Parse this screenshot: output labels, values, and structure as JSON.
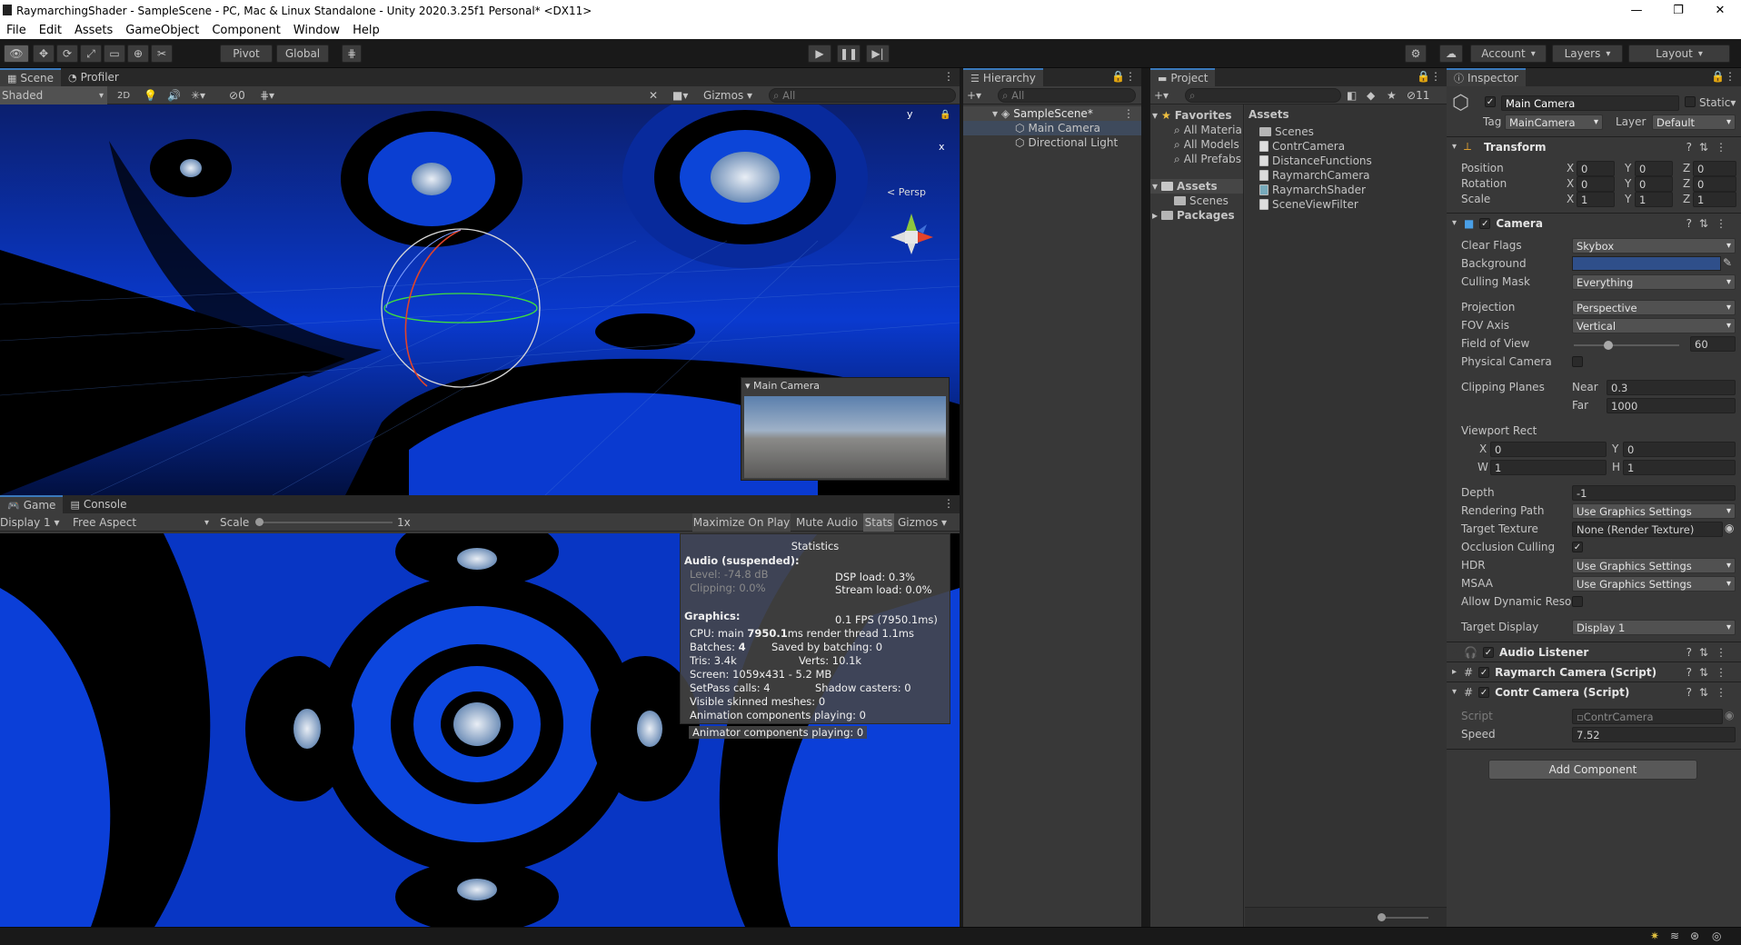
{
  "window": {
    "title": "RaymarchingShader - SampleScene - PC, Mac & Linux Standalone - Unity 2020.3.25f1 Personal* <DX11>",
    "minimize": "—",
    "maximize": "❐",
    "close": "✕"
  },
  "menu": [
    "File",
    "Edit",
    "Assets",
    "GameObject",
    "Component",
    "Window",
    "Help"
  ],
  "toolbar": {
    "pivot": "Pivot",
    "global": "Global",
    "account": "Account",
    "layers": "Layers",
    "layout": "Layout"
  },
  "scene": {
    "tab_scene": "Scene",
    "tab_profiler": "Profiler",
    "shading": "Shaded",
    "mode2d": "2D",
    "gizmos": "Gizmos",
    "search_placeholder": "All",
    "persp": "Persp",
    "axis_y": "y",
    "axis_x": "x",
    "hidden_count": "0",
    "cam_preview_title": "Main Camera"
  },
  "game": {
    "tab_game": "Game",
    "tab_console": "Console",
    "display": "Display 1",
    "aspect": "Free Aspect",
    "scale_label": "Scale",
    "scale_value": "1x",
    "maximize": "Maximize On Play",
    "mute": "Mute Audio",
    "stats": "Stats",
    "gizmos": "Gizmos",
    "statistics": {
      "title": "Statistics",
      "audio_header": "Audio (suspended):",
      "level": "Level: -74.8 dB",
      "clipping": "Clipping: 0.0%",
      "dsp": "DSP load: 0.3%",
      "stream": "Stream load: 0.0%",
      "graphics_header": "Graphics:",
      "fps": "0.1 FPS (7950.1ms)",
      "cpu_prefix": "CPU: main ",
      "cpu_main": "7950.1",
      "cpu_suffix": "ms  render thread 1.1ms",
      "batches_label": "Batches: ",
      "batches_value": "4",
      "saved": "Saved by batching: 0",
      "tris": "Tris: 3.4k",
      "verts": "Verts: 10.1k",
      "screen": "Screen: 1059x431 - 5.2 MB",
      "setpass": "SetPass calls: 4",
      "shadow": "Shadow casters: 0",
      "skinned": "Visible skinned meshes: 0",
      "anim": "Animation components playing: 0",
      "animator": "Animator components playing: 0"
    }
  },
  "hierarchy": {
    "tab": "Hierarchy",
    "search_placeholder": "All",
    "scene": "SampleScene*",
    "items": [
      "Main Camera",
      "Directional Light"
    ]
  },
  "project": {
    "tab": "Project",
    "badge": "11",
    "favorites": "Favorites",
    "fav_items": [
      "All Materia",
      "All Models",
      "All Prefabs"
    ],
    "assets": "Assets",
    "assets_children": [
      "Scenes"
    ],
    "packages": "Packages",
    "content_header": "Assets",
    "content": [
      "Scenes",
      "ContrCamera",
      "DistanceFunctions",
      "RaymarchCamera",
      "RaymarchShader",
      "SceneViewFilter"
    ]
  },
  "inspector": {
    "tab": "Inspector",
    "name": "Main Camera",
    "static": "Static",
    "tag_label": "Tag",
    "tag": "MainCamera",
    "layer_label": "Layer",
    "layer": "Default",
    "transform": {
      "title": "Transform",
      "rows": [
        {
          "label": "Position",
          "x": "0",
          "y": "0",
          "z": "0"
        },
        {
          "label": "Rotation",
          "x": "0",
          "y": "0",
          "z": "0"
        },
        {
          "label": "Scale",
          "x": "1",
          "y": "1",
          "z": "1"
        }
      ]
    },
    "camera": {
      "title": "Camera",
      "clear_flags": "Clear Flags",
      "clear_flags_v": "Skybox",
      "background": "Background",
      "background_color": "#2f4f8a",
      "culling": "Culling Mask",
      "culling_v": "Everything",
      "projection": "Projection",
      "projection_v": "Perspective",
      "fov_axis": "FOV Axis",
      "fov_axis_v": "Vertical",
      "fov": "Field of View",
      "fov_v": "60",
      "fov_fraction": 0.33,
      "physical": "Physical Camera",
      "clipping": "Clipping Planes",
      "near": "Near",
      "near_v": "0.3",
      "far": "Far",
      "far_v": "1000",
      "viewport": "Viewport Rect",
      "vx": "0",
      "vy": "0",
      "vw": "1",
      "vh": "1",
      "depth": "Depth",
      "depth_v": "-1",
      "rpath": "Rendering Path",
      "rpath_v": "Use Graphics Settings",
      "target_tex": "Target Texture",
      "target_tex_v": "None (Render Texture)",
      "occlusion": "Occlusion Culling",
      "hdr": "HDR",
      "hdr_v": "Use Graphics Settings",
      "msaa": "MSAA",
      "msaa_v": "Use Graphics Settings",
      "dyn": "Allow Dynamic Resol",
      "target_display": "Target Display",
      "target_display_v": "Display 1"
    },
    "audio_listener": "Audio Listener",
    "raymarch": "Raymarch Camera (Script)",
    "contr": "Contr Camera (Script)",
    "script_label": "Script",
    "script_v": "ContrCamera",
    "speed_label": "Speed",
    "speed_v": "7.52",
    "add_component": "Add Component"
  },
  "colors": {
    "accent": "#3a79bb",
    "panel": "#383838",
    "scene_blue": "#0a3ad0"
  }
}
